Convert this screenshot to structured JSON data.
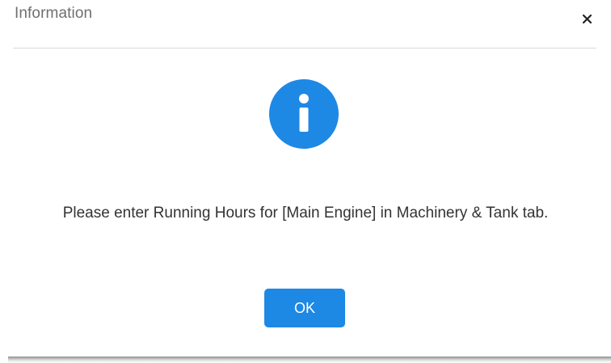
{
  "dialog": {
    "title": "Information",
    "close_icon": "close-icon",
    "status_icon": "info-icon",
    "message": "Please enter Running Hours for [Main Engine] in Machinery & Tank tab.",
    "ok_label": "OK"
  },
  "colors": {
    "accent": "#1e88e5",
    "title_text": "#6f6f6f",
    "body_text": "#333333",
    "divider": "#d9d9d9"
  }
}
